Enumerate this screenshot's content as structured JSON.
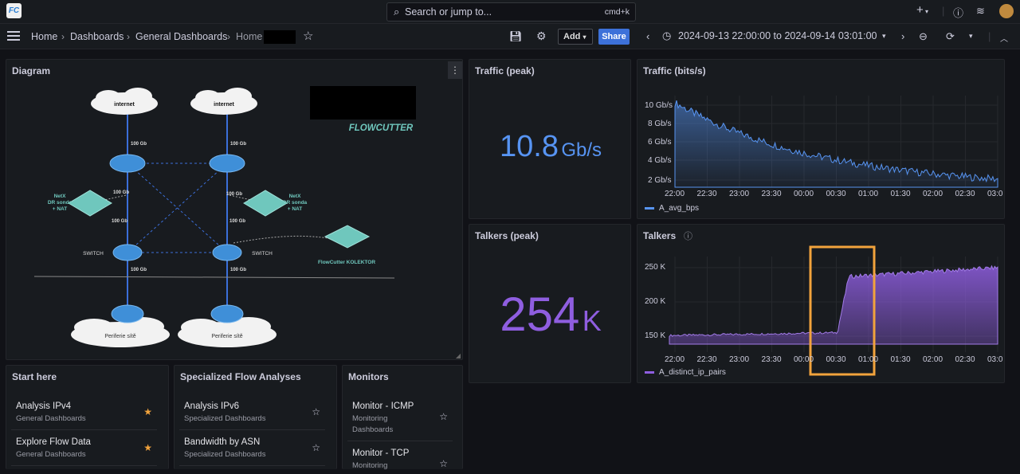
{
  "topbar": {
    "search_placeholder": "Search or jump to...",
    "search_shortcut": "cmd+k",
    "plus_label": "+"
  },
  "navbar": {
    "breadcrumbs": [
      "Home",
      "Dashboards",
      "General Dashboards",
      "Home"
    ],
    "add_label": "Add",
    "share_label": "Share",
    "time_range": "2024-09-13 22:00:00 to 2024-09-14 03:01:00"
  },
  "diagram": {
    "title": "Diagram",
    "labels": {
      "internet": "internet",
      "link": "100 Gb",
      "netx": [
        "NetX",
        "DR sonda",
        "+ NAT"
      ],
      "switch": "SWITCH",
      "collector": "FlowCutter KOLEKTOR",
      "periphery": "Periferie sítě",
      "brand": "FLOWCUTTER"
    }
  },
  "traffic_peak": {
    "title": "Traffic (peak)",
    "value": "10.8",
    "unit": "Gb/s",
    "color": "#5794f2"
  },
  "talkers_peak": {
    "title": "Talkers (peak)",
    "value": "254",
    "unit": "K",
    "color": "#8f5ee0"
  },
  "traffic_chart": {
    "title": "Traffic (bits/s)",
    "yticks": [
      "10 Gb/s",
      "8 Gb/s",
      "6 Gb/s",
      "4 Gb/s",
      "2 Gb/s"
    ],
    "xticks": [
      "22:00",
      "22:30",
      "23:00",
      "23:30",
      "00:00",
      "00:30",
      "01:00",
      "01:30",
      "02:00",
      "02:30",
      "03:0"
    ],
    "legend": "A_avg_bps",
    "color": "#5794f2"
  },
  "talkers_chart": {
    "title": "Talkers",
    "yticks": [
      "250 K",
      "200 K",
      "150 K"
    ],
    "xticks": [
      "22:00",
      "22:30",
      "23:00",
      "23:30",
      "00:00",
      "00:30",
      "01:00",
      "01:30",
      "02:00",
      "02:30",
      "03:0"
    ],
    "legend": "A_distinct_ip_pairs",
    "color": "#8f5ee0",
    "highlight_color": "#f2a33c"
  },
  "start_here": {
    "title": "Start here",
    "items": [
      {
        "title": "Analysis IPv4",
        "sub": "General Dashboards",
        "starred": true
      },
      {
        "title": "Explore Flow Data",
        "sub": "General Dashboards",
        "starred": true
      }
    ]
  },
  "specialized": {
    "title": "Specialized Flow Analyses",
    "items": [
      {
        "title": "Analysis IPv6",
        "sub": "Specialized Dashboards",
        "starred": false
      },
      {
        "title": "Bandwidth by ASN",
        "sub": "Specialized Dashboards",
        "starred": false
      }
    ]
  },
  "monitors": {
    "title": "Monitors",
    "items": [
      {
        "title": "Monitor - ICMP",
        "sub": "Monitoring",
        "sub2": "Dashboards",
        "starred": false
      },
      {
        "title": "Monitor - TCP",
        "sub": "Monitoring",
        "starred": false
      }
    ]
  }
}
